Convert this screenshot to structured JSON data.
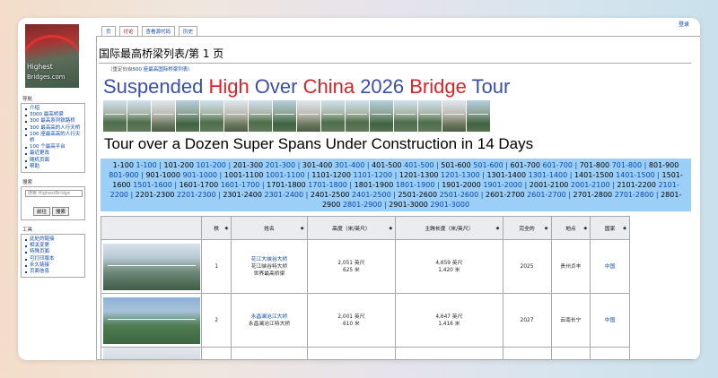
{
  "header": {
    "login": "登录"
  },
  "logo": {
    "line1": "Highest",
    "line2": "Bridges.com"
  },
  "tabs": [
    {
      "label": "页"
    },
    {
      "label": "讨论"
    },
    {
      "label": "查看源代码"
    },
    {
      "label": "历史"
    }
  ],
  "sidebar": {
    "nav_title": "导航",
    "nav_items": [
      "介绍",
      "3000 最高桥梁",
      "300 最高系列铁路桥",
      "300 最高高的人行天桥",
      "100 座最高高的人行天桥",
      "100 个最高平台",
      "最近更改",
      "随机页面",
      "帮助"
    ],
    "search_title": "搜索",
    "search_placeholder": "搜索 HighestBridge",
    "go_button": "前往",
    "search_button": "搜索",
    "tools_title": "工具",
    "tools_items": [
      "此处的链接",
      "相关变更",
      "特殊页面",
      "可打印版本",
      "永久链接",
      "页面信息"
    ]
  },
  "page": {
    "title": "国际最高桥梁列表/第 1 页",
    "redirect_prefix": "（重定向自",
    "redirect_link": "500 座最高国际桥梁列表",
    "redirect_suffix": "）",
    "banner": [
      {
        "text": "Suspended ",
        "color": "#3b4fa8"
      },
      {
        "text": "High ",
        "color": "#d8232a"
      },
      {
        "text": "Over ",
        "color": "#3b4fa8"
      },
      {
        "text": "China ",
        "color": "#d8232a"
      },
      {
        "text": "2026 ",
        "color": "#3b4fa8"
      },
      {
        "text": "Bridge ",
        "color": "#d8232a"
      },
      {
        "text": "Tour",
        "color": "#3b4fa8"
      }
    ],
    "subtitle": "Tour over a Dozen Super Spans Under Construction in 14 Days"
  },
  "pagination": [
    [
      "1-100",
      "1-100"
    ],
    [
      "101-200",
      "101-200"
    ],
    [
      "201-300",
      "201-300"
    ],
    [
      "301-400",
      "301-400"
    ],
    [
      "401-500",
      "401-500"
    ],
    [
      "501-600",
      "501-600"
    ],
    [
      "601-700",
      "601-700"
    ],
    [
      "701-800",
      "701-800"
    ],
    [
      "801-900",
      "801-900"
    ],
    [
      "901-1000",
      "901-1000"
    ],
    [
      "1001-1100",
      "1001-1100"
    ],
    [
      "1101-1200",
      "1101-1200"
    ],
    [
      "1201-1300",
      "1201-1300"
    ],
    [
      "1301-1400",
      "1301-1400"
    ],
    [
      "1401-1500",
      "1401-1500"
    ],
    [
      "1501-1600",
      "1501-1600"
    ],
    [
      "1601-1700",
      "1601-1700"
    ],
    [
      "1701-1800",
      "1701-1800"
    ],
    [
      "1801-1900",
      "1801-1900"
    ],
    [
      "1901-2000",
      "1901-2000"
    ],
    [
      "2001-2100",
      "2001-2100"
    ],
    [
      "2101-2200",
      "2101-2200"
    ],
    [
      "2201-2300",
      "2201-2300"
    ],
    [
      "2301-2400",
      "2301-2400"
    ],
    [
      "2401-2500",
      "2401-2500"
    ],
    [
      "2501-2600",
      "2501-2600"
    ],
    [
      "2601-2700",
      "2601-2700"
    ],
    [
      "2701-2800",
      "2701-2800"
    ],
    [
      "2801-2900",
      "2801-2900"
    ],
    [
      "2901-3000",
      "2901-3000"
    ]
  ],
  "table": {
    "headers": [
      "",
      "秩",
      "姓名",
      "高度（米/英尺）",
      "主跨长度（米/英尺）",
      "完全的",
      "地点",
      "国家"
    ],
    "rows": [
      {
        "rank": "1",
        "name_link": "花江大峡谷大桥",
        "name_alt": "花江峡谷特大桥",
        "note": "世界最高桥梁",
        "height_ft": "2,051 英尺",
        "height_m": "625 米",
        "span_ft": "4,659 英尺",
        "span_m": "1,420 米",
        "year": "2025",
        "location": "贵州贞丰",
        "country": "中国"
      },
      {
        "rank": "2",
        "name_link": "永昌澜沧江大桥",
        "name_alt": "永昌澜沧江特大桥",
        "note": "",
        "height_ft": "2,001 英尺",
        "height_m": "610 米",
        "span_ft": "4,647 英尺",
        "span_m": "1,416 米",
        "year": "2027",
        "location": "云南长宁",
        "country": "中国"
      }
    ]
  }
}
